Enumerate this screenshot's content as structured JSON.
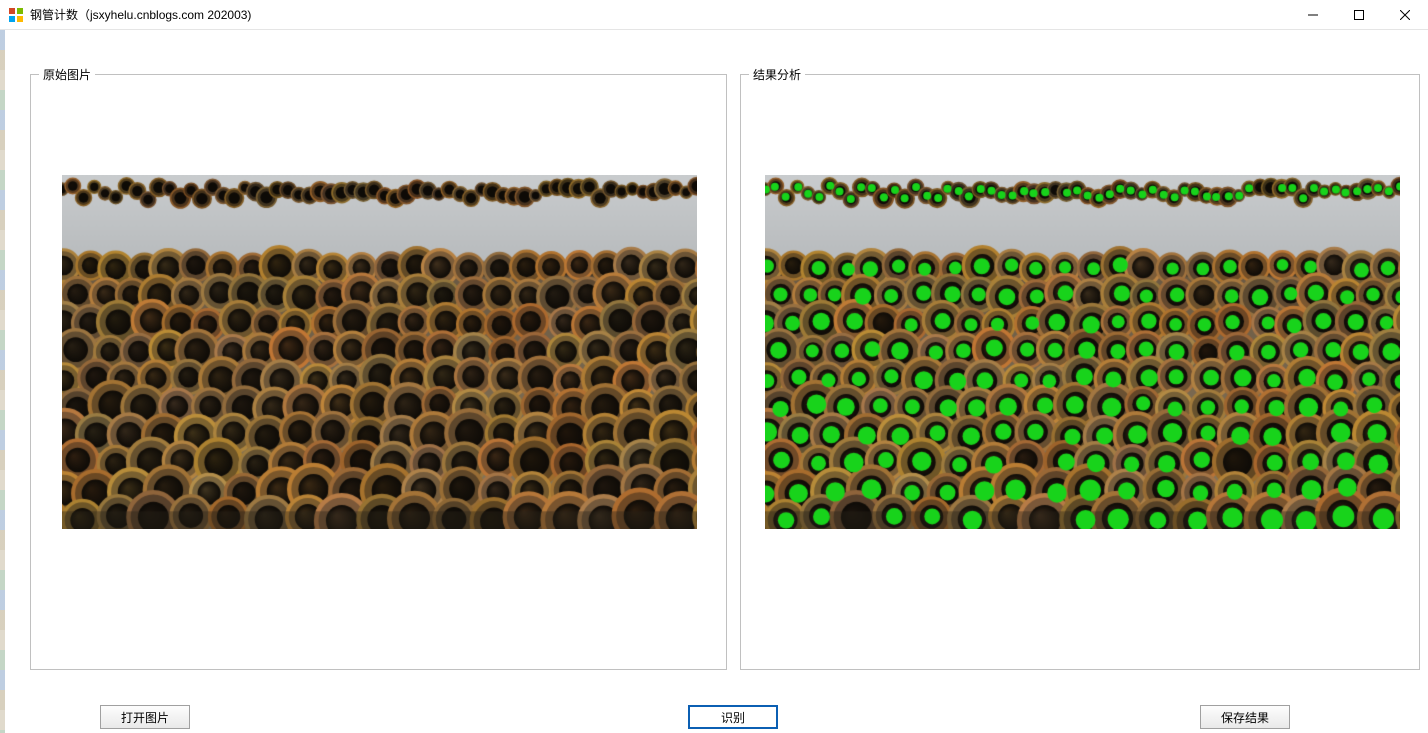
{
  "window": {
    "title": "钢管计数（jsxyhelu.cnblogs.com 202003)"
  },
  "groups": {
    "original_label": "原始图片",
    "result_label": "结果分析"
  },
  "buttons": {
    "open_label": "打开图片",
    "recognize_label": "识别",
    "save_label": "保存结果"
  },
  "colors": {
    "marker": "#18d31b",
    "focus_border": "#0b5fb3"
  },
  "image": {
    "description": "stacked steel pipes"
  }
}
